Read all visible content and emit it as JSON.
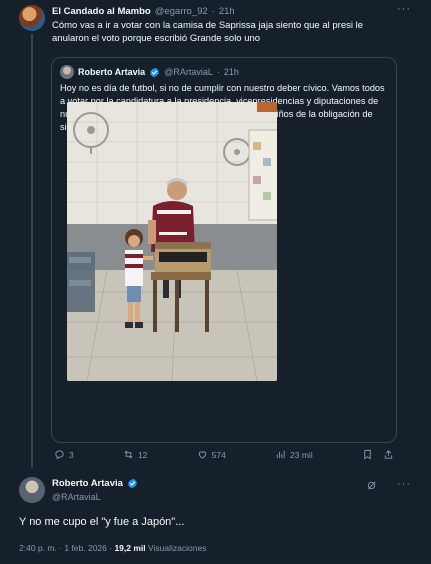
{
  "reply": {
    "name": "El Candado al Mambo",
    "handle": "@egarro_92",
    "dot": "·",
    "time": "21h",
    "text": "Cómo vas a ir a votar con la camisa de Saprissa jaja siento que al presi le anularon el voto porque escribió Grande solo uno",
    "more": "···"
  },
  "quote": {
    "name": "Roberto Artavia",
    "handle": "@RArtaviaL",
    "dot": "·",
    "time": "21h",
    "text": "Hoy no es día de futbol, si no de cumplir con nuestro deber cívico. Vamos todos a votar por la candidatura a la presidencia, vicepresidencias y diputaciones de nuestra preferencia, y demos el ejemplo a nuestros niños de la obligación de siempre cumplir con la patria",
    "flag_icon": "costa-rica-flag-icon",
    "image_alt": "Man in burgundy jersey casting a vote at a cardboard ballot box next to a child, in a classroom with fans on the wall"
  },
  "reply_actions": {
    "replies": "3",
    "retweets": "12",
    "likes": "574",
    "views": "23 mil"
  },
  "main": {
    "name": "Roberto Artavia",
    "handle": "@RArtaviaL",
    "text": "Y no me cupo el \"y fue a Japón\"...",
    "time_date": "2:40 p. m. · 1 feb. 2026 · ",
    "views_count": "19,2 mil",
    "views_label": " Visualizaciones"
  },
  "colors": {
    "background": "#15202b",
    "border": "#38444d",
    "muted": "#8b98a5",
    "verified": "#1d9bf0",
    "text": "#f7f9f9"
  }
}
